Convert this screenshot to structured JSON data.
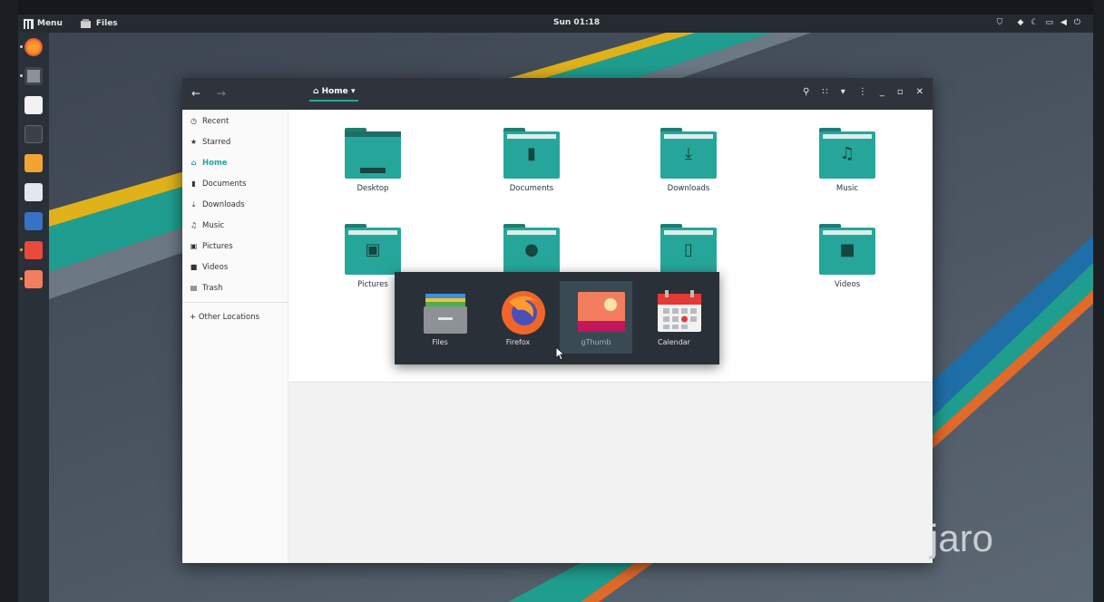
{
  "topbar": {
    "menu_label": "Menu",
    "files_label": "Files",
    "clock": "Sun 01:18",
    "tray_icons": [
      "shield-icon",
      "network-icon",
      "night-light-icon",
      "display-icon",
      "volume-icon",
      "power-icon"
    ]
  },
  "dock": {
    "items": [
      "firefox-icon",
      "files-icon",
      "text-editor-icon",
      "terminal-icon",
      "downloads-icon",
      "search-app-icon",
      "screenshot-icon",
      "calendar-icon",
      "gthumb-icon"
    ]
  },
  "window": {
    "location": "Home",
    "sidebar": [
      {
        "label": "Recent",
        "icon": "clock-icon"
      },
      {
        "label": "Starred",
        "icon": "star-icon"
      },
      {
        "label": "Home",
        "icon": "home-icon"
      },
      {
        "label": "Documents",
        "icon": "document-icon"
      },
      {
        "label": "Downloads",
        "icon": "download-icon"
      },
      {
        "label": "Music",
        "icon": "music-icon"
      },
      {
        "label": "Pictures",
        "icon": "picture-icon"
      },
      {
        "label": "Videos",
        "icon": "video-icon"
      },
      {
        "label": "Trash",
        "icon": "trash-icon"
      },
      {
        "label": "+ Other Locations",
        "icon": "plus-icon"
      }
    ],
    "folders": [
      {
        "label": "Desktop"
      },
      {
        "label": "Documents"
      },
      {
        "label": "Downloads"
      },
      {
        "label": "Music"
      },
      {
        "label": "Pictures"
      },
      {
        "label": ""
      },
      {
        "label": ""
      },
      {
        "label": "Videos"
      }
    ]
  },
  "switcher": {
    "apps": [
      {
        "label": "Files"
      },
      {
        "label": "Firefox"
      },
      {
        "label": "gThumb"
      },
      {
        "label": "Calendar"
      }
    ],
    "selected": "gThumb"
  },
  "watermark": "jaro",
  "colors": {
    "accent": "#26a69a",
    "panel": "#262b32",
    "header": "#2f343c"
  }
}
